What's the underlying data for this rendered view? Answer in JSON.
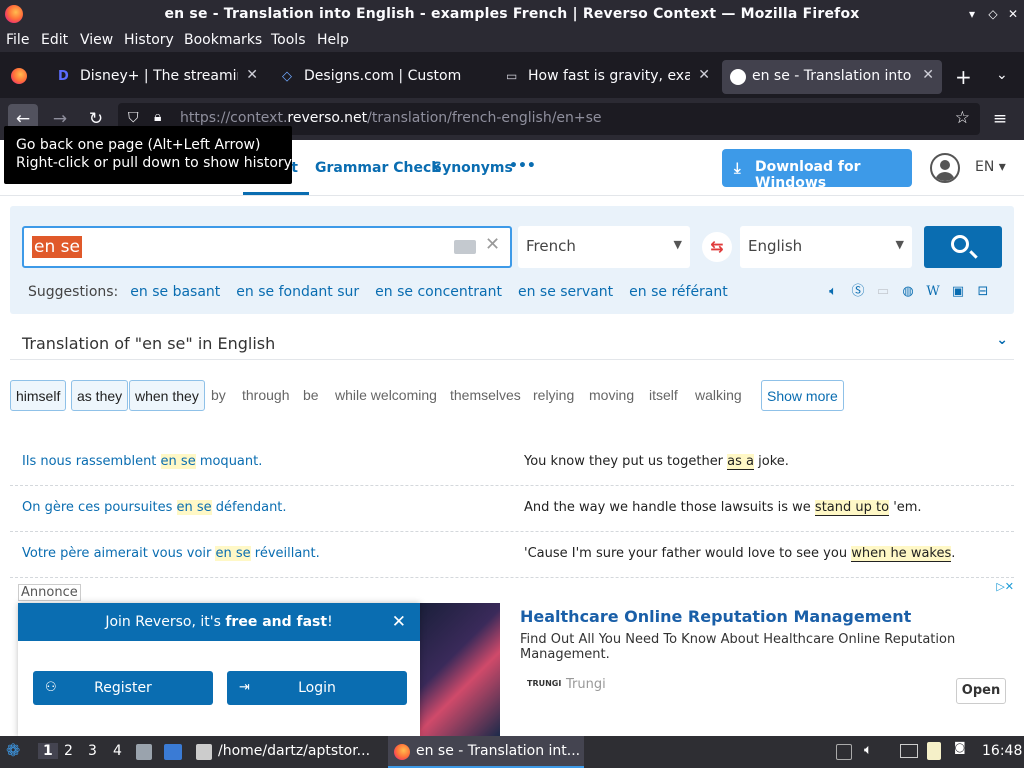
{
  "window": {
    "title": "en se - Translation into English - examples French | Reverso Context — Mozilla Firefox"
  },
  "menu": [
    "File",
    "Edit",
    "View",
    "History",
    "Bookmarks",
    "Tools",
    "Help"
  ],
  "tabs": [
    {
      "label": "Disney+ | The streaming",
      "active": false
    },
    {
      "label": "Designs.com | Custom De",
      "active": false
    },
    {
      "label": "How fast is gravity, exact",
      "active": false
    },
    {
      "label": "en se - Translation into E",
      "active": true
    }
  ],
  "urlbar": {
    "prefix": "https://context.",
    "domain": "reverso.net",
    "path": "/translation/french-english/en+se"
  },
  "tooltip": {
    "line1": "Go back one page (Alt+Left Arrow)",
    "line2": "Right-click or pull down to show history"
  },
  "site_nav": {
    "context_partial": "ct",
    "grammar": "Grammar Check",
    "synonyms": "Synonyms",
    "more": "•••",
    "download": "Download for Windows",
    "lang": "EN"
  },
  "search": {
    "query": "en se",
    "source_lang": "French",
    "target_lang": "English",
    "suggestions_label": "Suggestions:",
    "suggestions": [
      "en se basant",
      "en se fondant sur",
      "en se concentrant",
      "en se servant",
      "en se référant"
    ]
  },
  "translation_header": "Translation of \"en se\" in English",
  "chips": [
    {
      "label": "himself",
      "boxed": true
    },
    {
      "label": "as they",
      "boxed": true
    },
    {
      "label": "when they",
      "boxed": true
    },
    {
      "label": "by",
      "boxed": false
    },
    {
      "label": "through",
      "boxed": false
    },
    {
      "label": "be",
      "boxed": false
    },
    {
      "label": "while welcoming",
      "boxed": false
    },
    {
      "label": "themselves",
      "boxed": false
    },
    {
      "label": "relying",
      "boxed": false
    },
    {
      "label": "moving",
      "boxed": false
    },
    {
      "label": "itself",
      "boxed": false
    },
    {
      "label": "walking",
      "boxed": false
    }
  ],
  "show_more": "Show more",
  "examples": [
    {
      "src_pre": "Ils nous rassemblent ",
      "src_hl": "en se",
      "src_post": " moquant.",
      "tgt_pre": "You know they put us together ",
      "tgt_hl": "as a",
      "tgt_post": " joke."
    },
    {
      "src_pre": "On gère ces poursuites ",
      "src_hl": "en se",
      "src_post": " défendant.",
      "tgt_pre": "And the way we handle those lawsuits is we ",
      "tgt_hl": "stand up to",
      "tgt_post": " 'em."
    },
    {
      "src_pre": "Votre père aimerait vous voir ",
      "src_hl": "en se",
      "src_post": " réveillant.",
      "tgt_pre": "'Cause I'm sure your father would love to see you ",
      "tgt_hl": "when he wakes",
      "tgt_post": "."
    }
  ],
  "ad": {
    "annonce": "Annonce",
    "title": "Healthcare Online Reputation Management",
    "desc": "Find Out All You Need To Know About Healthcare Online Reputation Management.",
    "brand_logo": "TRUNGI",
    "brand": "Trungi",
    "open": "Open"
  },
  "popup": {
    "text_pre": "Join Reverso, it's ",
    "text_bold": "free and fast",
    "text_post": "!",
    "register": "Register",
    "login": "Login"
  },
  "taskbar": {
    "workspaces": [
      "1",
      "2",
      "3",
      "4"
    ],
    "terminal": "/home/dartz/aptstor...",
    "browser": "en se - Translation int...",
    "time": "16:48"
  },
  "colors": {
    "accent": "#0a6db1",
    "highlight": "#e0592a",
    "download": "#3d9ae8"
  }
}
